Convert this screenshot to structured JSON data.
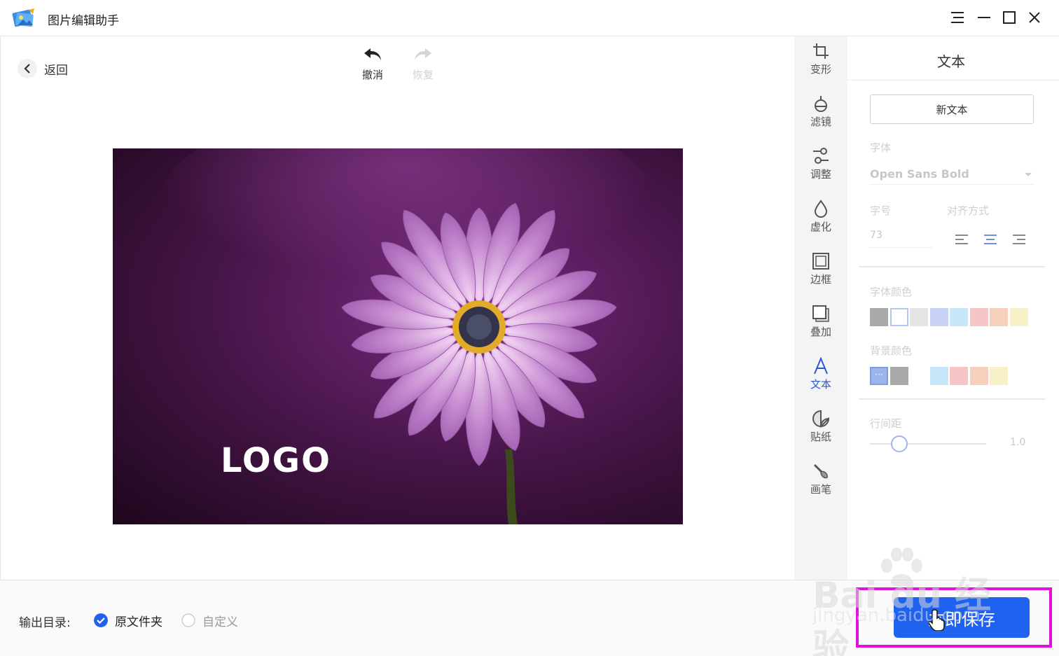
{
  "app": {
    "title": "图片编辑助手"
  },
  "window": {
    "menu_icon": "menu-icon",
    "minimize_icon": "minimize-icon",
    "maximize_icon": "maximize-icon",
    "close_icon": "close-icon"
  },
  "editor": {
    "back_label": "返回",
    "undo_label": "撤消",
    "redo_label": "恢复",
    "image_overlay_text": "LOGO"
  },
  "tools": [
    {
      "label": "变形",
      "icon": "crop-icon"
    },
    {
      "label": "滤镜",
      "icon": "filter-icon"
    },
    {
      "label": "调整",
      "icon": "adjust-icon"
    },
    {
      "label": "虚化",
      "icon": "blur-icon"
    },
    {
      "label": "边框",
      "icon": "border-icon"
    },
    {
      "label": "叠加",
      "icon": "overlay-icon"
    },
    {
      "label": "文本",
      "icon": "text-icon",
      "active": true
    },
    {
      "label": "贴纸",
      "icon": "sticker-icon"
    },
    {
      "label": "画笔",
      "icon": "brush-icon"
    }
  ],
  "panel": {
    "title": "文本",
    "new_text_label": "新文本",
    "font_label": "字体",
    "font_value": "Open Sans Bold",
    "size_label": "字号",
    "size_value": "73",
    "align_label": "对齐方式",
    "align_selected": "center",
    "font_color_label": "字体颜色",
    "font_colors": [
      "#a9a9a9",
      "#ffffff",
      "#e5e5e5",
      "#c8d3f7",
      "#c7e6f9",
      "#f6c5c5",
      "#f7d0bd",
      "#f8f1c8"
    ],
    "bg_color_label": "背景颜色",
    "bg_colors": [
      "#a9a9a9",
      "#c8d3f7",
      "#c7e6f9",
      "#f6c5c5",
      "#f7d0bd",
      "#f8f1c8"
    ],
    "line_spacing_label": "行间距",
    "line_spacing_value": "1.0",
    "line_spacing_fraction": 0.25
  },
  "bottom": {
    "output_label": "输出目录:",
    "option_original": "原文件夹",
    "option_custom": "自定义",
    "selected": "original",
    "save_label": "立即保存"
  },
  "watermark": {
    "brand": "Bai du 经验",
    "url": "jingyan.baidu.com"
  },
  "colors": {
    "accent": "#2062f0",
    "highlight": "#e011d8",
    "active_tool": "#2b57d6"
  }
}
